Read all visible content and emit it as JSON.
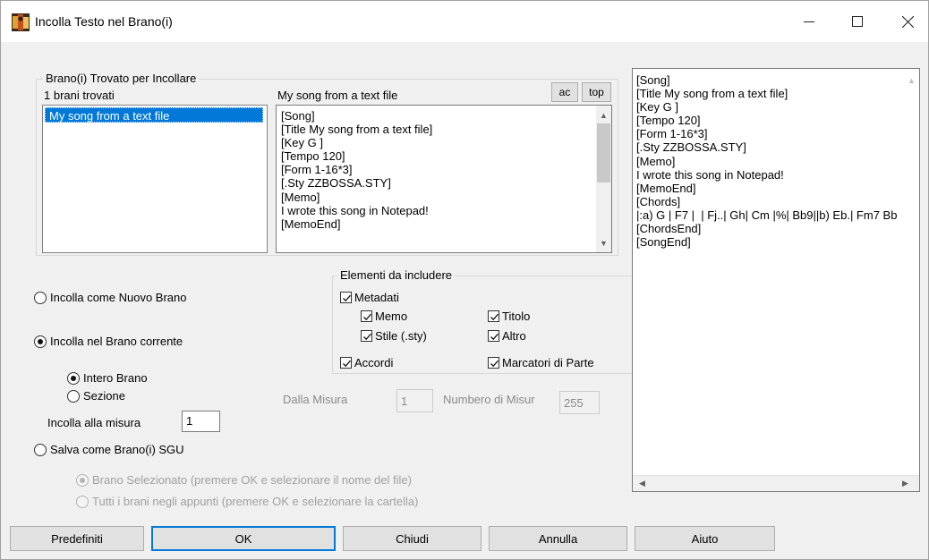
{
  "window": {
    "title": "Incolla Testo nel Brano(i)",
    "controls": {
      "minimize": "—",
      "maximize": "☐",
      "close": "✕"
    }
  },
  "found_group": {
    "legend": "Brano(i) Trovato per Incollare",
    "count_label": "1 brani trovati",
    "songs": [
      "My song from a text file"
    ],
    "preview_title": "My song from a text file",
    "ac_label": "ac",
    "top_label": "top",
    "preview_lines": [
      "[Song]",
      "[Title My song from a text file]",
      "[Key G ]",
      "[Tempo 120]",
      "[Form 1-16*3]",
      "[.Sty ZZBOSSA.STY]",
      "[Memo]",
      "I wrote this song in Notepad!",
      "[MemoEnd]"
    ]
  },
  "paste_options": {
    "new_song": "Incolla come Nuovo Brano",
    "current_song": "Incolla nel Brano corrente",
    "whole_song": "Intero Brano",
    "section": "Sezione",
    "paste_at_bar_label": "Incolla alla misura",
    "paste_at_bar_value": "1",
    "save_sgu": "Salva come Brano(i) SGU",
    "selected_song": "Brano Selezionato (premere OK e selezionare il nome del file)",
    "all_songs": "Tutti i brani negli appunti (premere OK e selezionare la cartella)"
  },
  "range": {
    "from_bar_label": "Dalla Misura",
    "from_bar_value": "1",
    "num_bars_label": "Numbero di Misur",
    "num_bars_value": "255"
  },
  "include_group": {
    "legend": "Elementi da includere",
    "metadata": "Metadati",
    "memo": "Memo",
    "title": "Titolo",
    "style": "Stile (.sty)",
    "other": "Altro",
    "chords": "Accordi",
    "part_markers": "Marcatori di Parte"
  },
  "full_text": {
    "lines": [
      "[Song]",
      "[Title My song from a text file]",
      "[Key G ]",
      "[Tempo 120]",
      "[Form 1-16*3]",
      "[.Sty ZZBOSSA.STY]",
      "[Memo]",
      "I wrote this song in Notepad!",
      "[MemoEnd]",
      "[Chords]",
      "|:a) G | F7 |  | Fj..| Gh| Cm |%| Bb9||b) Eb.| Fm7 Bb",
      "[ChordsEnd]",
      "[SongEnd]"
    ]
  },
  "buttons": {
    "defaults": "Predefiniti",
    "ok": "OK",
    "close": "Chiudi",
    "cancel": "Annulla",
    "help": "Aiuto"
  },
  "colors": {
    "selection": "#0078d7",
    "default_button_border": "#0078d7"
  }
}
